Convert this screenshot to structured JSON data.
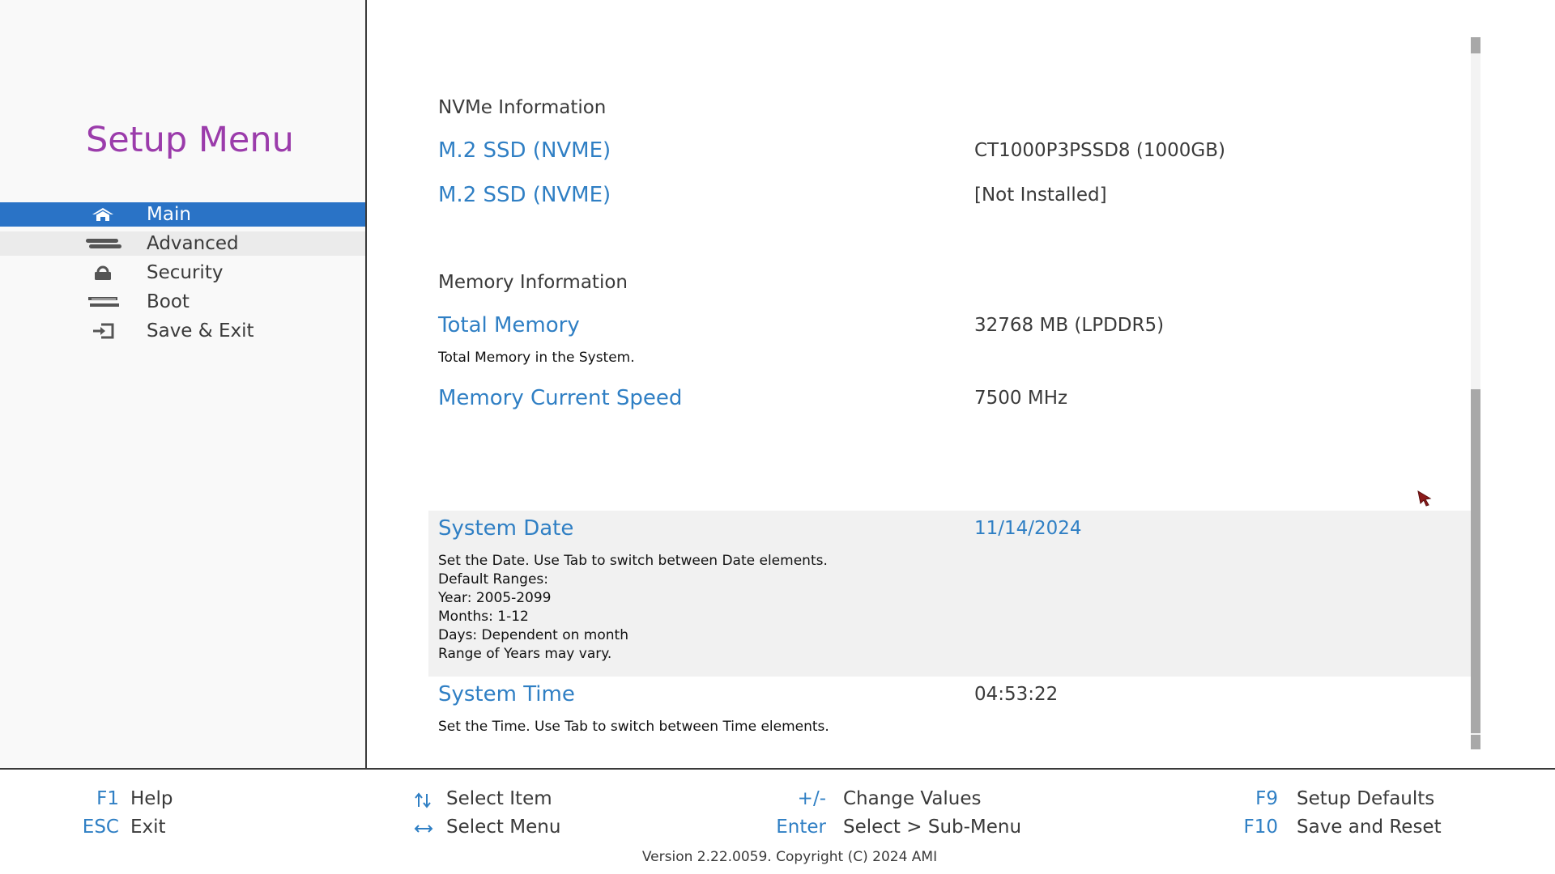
{
  "sidebar": {
    "title": "Setup Menu",
    "items": [
      {
        "label": "Main",
        "icon": "home-icon",
        "state": "selected"
      },
      {
        "label": "Advanced",
        "icon": "advanced-icon",
        "state": "hovered"
      },
      {
        "label": "Security",
        "icon": "lock-icon",
        "state": "normal"
      },
      {
        "label": "Boot",
        "icon": "boot-icon",
        "state": "normal"
      },
      {
        "label": "Save & Exit",
        "icon": "save-exit-icon",
        "state": "normal"
      }
    ]
  },
  "main": {
    "nvme": {
      "heading": "NVMe Information",
      "items": [
        {
          "label": "M.2 SSD (NVME)",
          "value": "CT1000P3PSSD8 (1000GB)"
        },
        {
          "label": "M.2 SSD (NVME)",
          "value": "[Not Installed]"
        }
      ]
    },
    "memory": {
      "heading": "Memory Information",
      "total_label": "Total Memory",
      "total_value": "32768 MB (LPDDR5)",
      "total_help": "Total Memory in the System.",
      "speed_label": "Memory Current Speed",
      "speed_value": "7500 MHz"
    },
    "system_date": {
      "label": "System Date",
      "value": "11/14/2024",
      "help": [
        "Set the Date. Use Tab to switch between Date elements.",
        "Default Ranges:",
        "Year: 2005-2099",
        "Months: 1-12",
        "Days: Dependent on month",
        "Range of Years may vary."
      ]
    },
    "system_time": {
      "label": "System Time",
      "value": "04:53:22",
      "help": "Set the Time. Use Tab to switch between Time elements."
    }
  },
  "footer": {
    "keys": [
      {
        "key": "F1",
        "desc": "Help"
      },
      {
        "key": "ESC",
        "desc": "Exit"
      },
      {
        "key": "↑↓",
        "desc": "Select Item"
      },
      {
        "key": "↔",
        "desc": "Select Menu"
      },
      {
        "key": "+/-",
        "desc": "Change Values"
      },
      {
        "key": "Enter",
        "desc": "Select > Sub-Menu"
      },
      {
        "key": "F9",
        "desc": "Setup Defaults"
      },
      {
        "key": "F10",
        "desc": "Save and Reset"
      }
    ],
    "version": "Version 2.22.0059. Copyright (C) 2024 AMI"
  },
  "colors": {
    "accent_blue": "#2f7fc4",
    "selected_bg": "#2a73c6",
    "title_purple": "#9b3cab",
    "highlight_bg": "#f1f1f1"
  }
}
